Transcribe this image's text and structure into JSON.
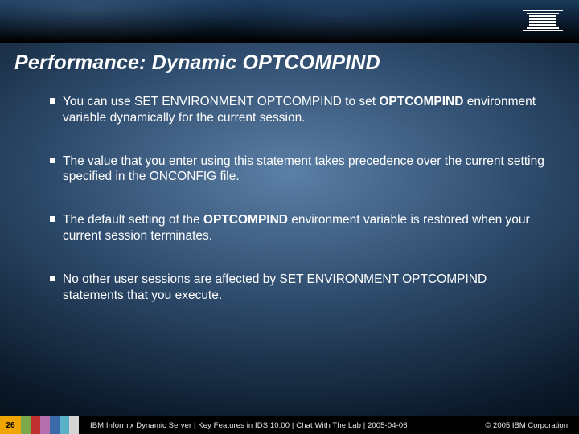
{
  "logo": {
    "name": "IBM"
  },
  "title": "Performance: Dynamic OPTCOMPIND",
  "bullets": [
    {
      "pre": "You can use SET ENVIRONMENT OPTCOMPIND to set ",
      "strong": "OPTCOMPIND",
      "post": " environment variable dynamically for the current session."
    },
    {
      "pre": "The value that you enter using this statement takes precedence over the current setting specified in the ONCONFIG file.",
      "strong": "",
      "post": ""
    },
    {
      "pre": "The default setting of the ",
      "strong": "OPTCOMPIND",
      "post": " environment variable is restored when your current session terminates."
    },
    {
      "pre": "No other user sessions are affected by SET ENVIRONMENT OPTCOMPIND statements that you execute.",
      "strong": "",
      "post": ""
    }
  ],
  "footer": {
    "page": "26",
    "text": "IBM Informix Dynamic Server | Key Features in IDS 10.00 | Chat With The Lab | 2005-04-06",
    "copyright": "© 2005 IBM Corporation"
  }
}
